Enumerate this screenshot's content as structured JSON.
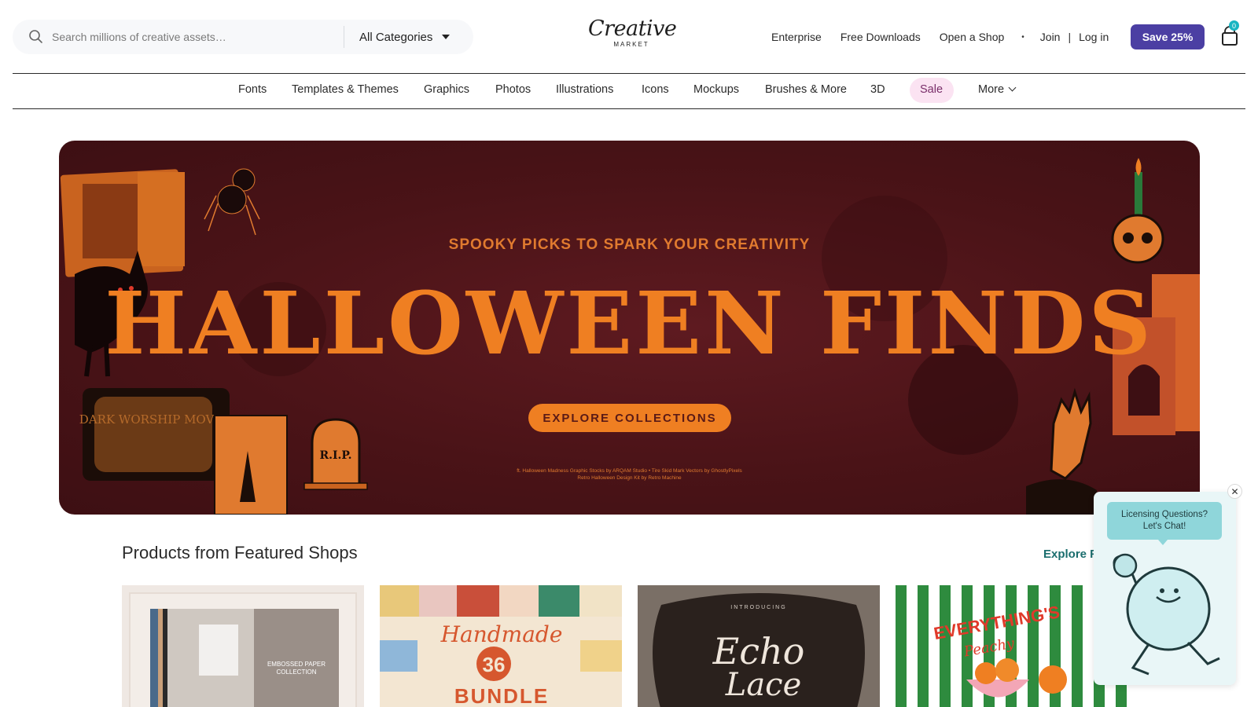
{
  "header": {
    "search": {
      "placeholder": "Search millions of creative assets…",
      "value": ""
    },
    "category_select": {
      "selected": "All Categories"
    },
    "logo": {
      "word": "Creative",
      "sub": "MARKET"
    },
    "links": {
      "enterprise": "Enterprise",
      "free_downloads": "Free Downloads",
      "open_shop": "Open a Shop",
      "dot": "•",
      "join": "Join",
      "pipe": "|",
      "login": "Log in"
    },
    "save_button": "Save 25%",
    "cart_count": "0"
  },
  "category_nav": {
    "items": [
      "Fonts",
      "Templates & Themes",
      "Graphics",
      "Photos",
      "Illustrations",
      "Icons",
      "Mockups",
      "Brushes & More",
      "3D",
      "Sale",
      "More"
    ]
  },
  "hero": {
    "kicker": "SPOOKY PICKS TO SPARK YOUR CREATIVITY",
    "title": "HALLOWEEN FINDS",
    "cta": "EXPLORE COLLECTIONS",
    "credit_line1": "ft. Halloween Madness Graphic Stocks by ARQAM Studio • Tire Skid Mark Vectors by GhostlyPixels",
    "credit_line2": "Retro Halloween Design Kit by Retro Machine",
    "art_labels": {
      "tv": "DARK WORSHIP MOVIE",
      "tombstone": "R.I.P."
    }
  },
  "featured": {
    "title": "Products from Featured Shops",
    "explore": "Explore F",
    "cards": [
      {
        "art_text_1": "EMBOSSED PAPER",
        "art_text_2": "COLLECTION"
      },
      {
        "art_text_1": "Handmade",
        "art_text_2": "BUNDLE",
        "art_text_3": "36"
      },
      {
        "art_text_1": "INTRODUCING",
        "art_text_2": "Echo",
        "art_text_3": "Lace"
      },
      {
        "art_text_1": "EVERYTHING'S",
        "art_text_2": "Peachy"
      }
    ]
  },
  "chat": {
    "line1": "Licensing Questions?",
    "line2": "Let's Chat!",
    "close": "✕"
  },
  "colors": {
    "accent_purple": "#4b3fa3",
    "hero_bg": "#4a1317",
    "hero_orange": "#ef7f22",
    "sale_pill": "#fbe3f2",
    "chat_teal": "#8fd6da"
  }
}
